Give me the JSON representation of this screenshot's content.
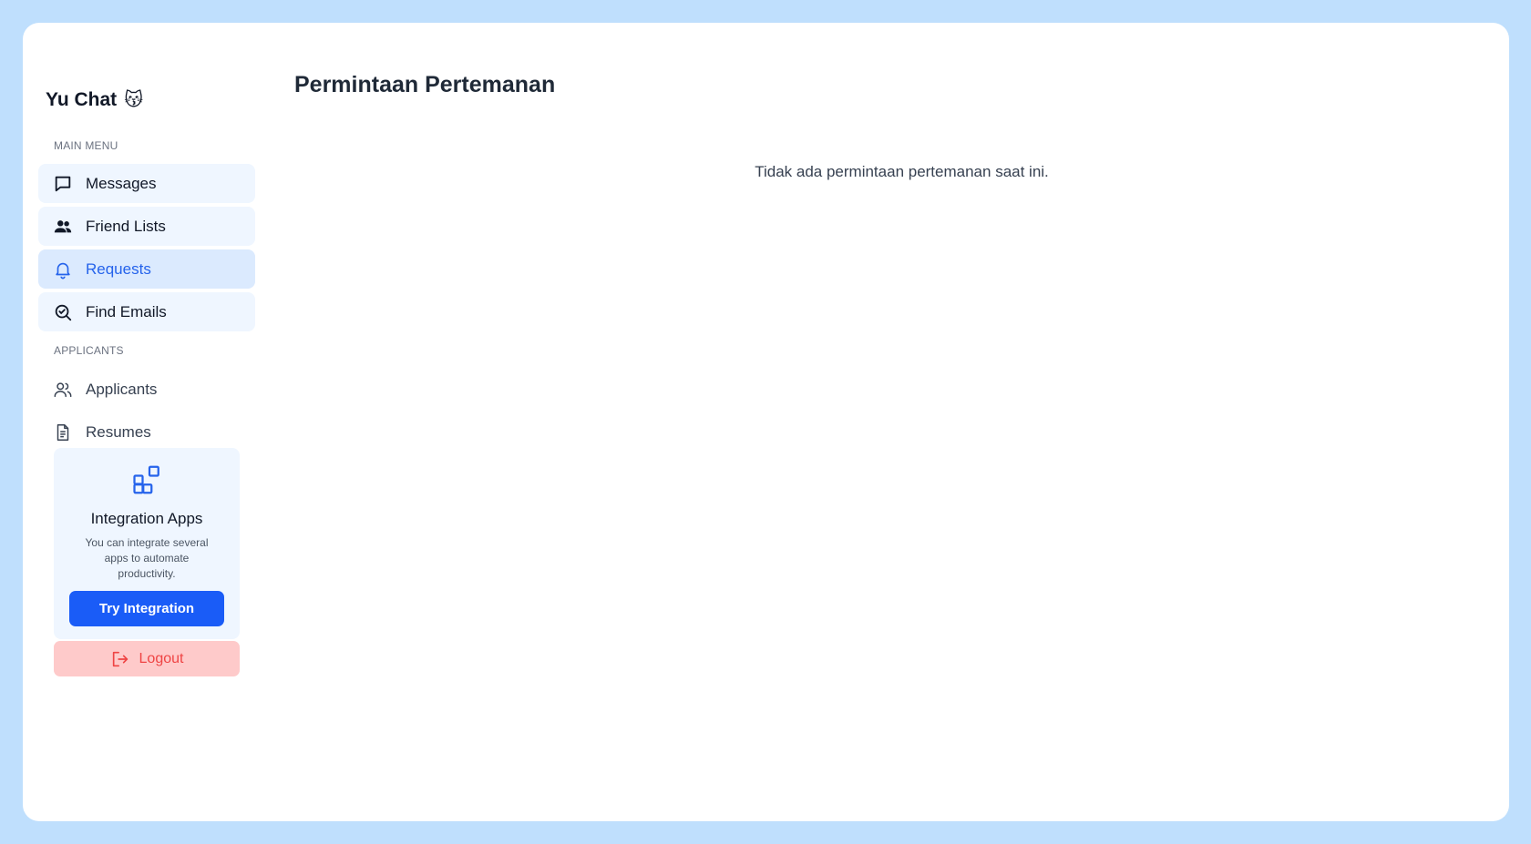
{
  "brand": {
    "name": "Yu Chat",
    "emoji": "😽"
  },
  "sidebar": {
    "main_menu_label": "MAIN MENU",
    "main_menu": [
      {
        "label": "Messages",
        "icon": "message-icon"
      },
      {
        "label": "Friend Lists",
        "icon": "users-icon"
      },
      {
        "label": "Requests",
        "icon": "bell-icon",
        "active": true
      },
      {
        "label": "Find Emails",
        "icon": "search-icon"
      }
    ],
    "applicants_label": "APPLICANTS",
    "applicants_menu": [
      {
        "label": "Applicants",
        "icon": "user-group-icon"
      },
      {
        "label": "Resumes",
        "icon": "document-icon"
      }
    ],
    "promo": {
      "icon": "apps-icon",
      "title": "Integration Apps",
      "description": "You can integrate several apps to automate productivity.",
      "button_label": "Try Integration"
    },
    "logout_label": "Logout"
  },
  "main": {
    "title": "Permintaan Pertemanan",
    "empty_message": "Tidak ada permintaan pertemanan saat ini."
  },
  "colors": {
    "background": "#bfdffd",
    "accent": "#1a5cf7",
    "active_text": "#2563eb",
    "nav_bg": "#eff6ff",
    "active_bg": "#dbeafe",
    "logout_bg": "#fecaca",
    "logout_text": "#ef4444"
  }
}
